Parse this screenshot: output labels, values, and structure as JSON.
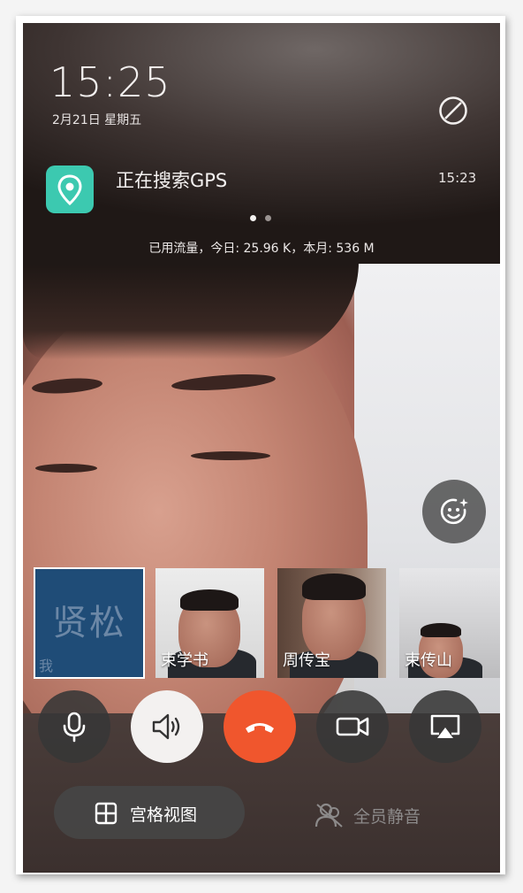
{
  "status": {
    "time": "15:25",
    "date": "2月21日 星期五"
  },
  "notification": {
    "icon": "location-pin-icon",
    "title": "正在搜索GPS",
    "time": "15:23",
    "accent_color": "#3cc9b0"
  },
  "data_usage": "已用流量，今日: 25.96 K，本月: 536 M",
  "participants": [
    {
      "avatar_text": "贤松",
      "name": "我",
      "tile_color": "#1f4c77",
      "is_self": true
    },
    {
      "name": "束学书"
    },
    {
      "name": "周传宝"
    },
    {
      "name": "束传山"
    }
  ],
  "controls": {
    "mic": "microphone-icon",
    "speaker": "speaker-icon",
    "hangup": "hang-up-icon",
    "camera": "video-camera-icon",
    "screen_share": "screen-share-icon",
    "hangup_color": "#f0562d"
  },
  "bottom": {
    "grid_view_label": "宫格视图",
    "mute_all_label": "全员静音"
  }
}
